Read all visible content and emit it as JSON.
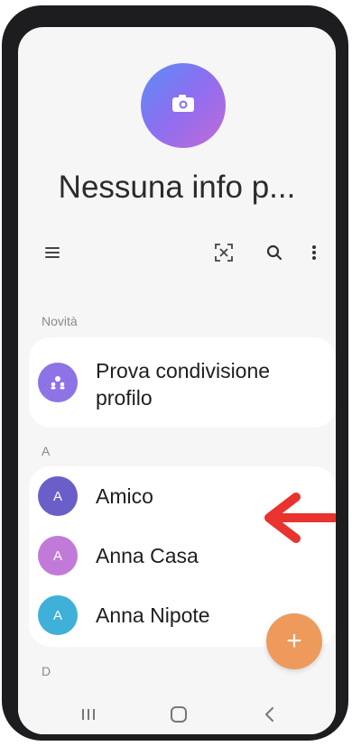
{
  "profile": {
    "name": "Nessuna info p...",
    "avatar_icon": "camera-icon",
    "avatar_gradient": [
      "#5b8cf8",
      "#8e6ef0",
      "#c26ad8"
    ]
  },
  "toolbar": {
    "menu_icon": "hamburger-menu-icon",
    "scan_icon": "qr-scan-icon",
    "search_icon": "search-icon",
    "more_icon": "more-vertical-icon"
  },
  "sections": {
    "new": "Novità",
    "a": "A",
    "d": "D"
  },
  "new_card": {
    "label": "Prova condivisione profilo",
    "line1": "Prova condivisione",
    "line2": "profilo",
    "icon": "people-share-icon",
    "color": "#8d73e6"
  },
  "contacts": [
    {
      "initial": "A",
      "name": "Amico",
      "color": "#6a5fc9"
    },
    {
      "initial": "A",
      "name": "Anna Casa",
      "color": "#c27ad9"
    },
    {
      "initial": "A",
      "name": "Anna Nipote",
      "color": "#3fb0d8"
    }
  ],
  "fab": {
    "label": "+",
    "color": "#ee9a5c"
  },
  "annotation": {
    "arrow_color": "#e8332e",
    "icon": "red-arrow-left-icon"
  },
  "navbar": {
    "recents": "recent-apps-icon",
    "home": "home-icon",
    "back": "back-icon"
  }
}
